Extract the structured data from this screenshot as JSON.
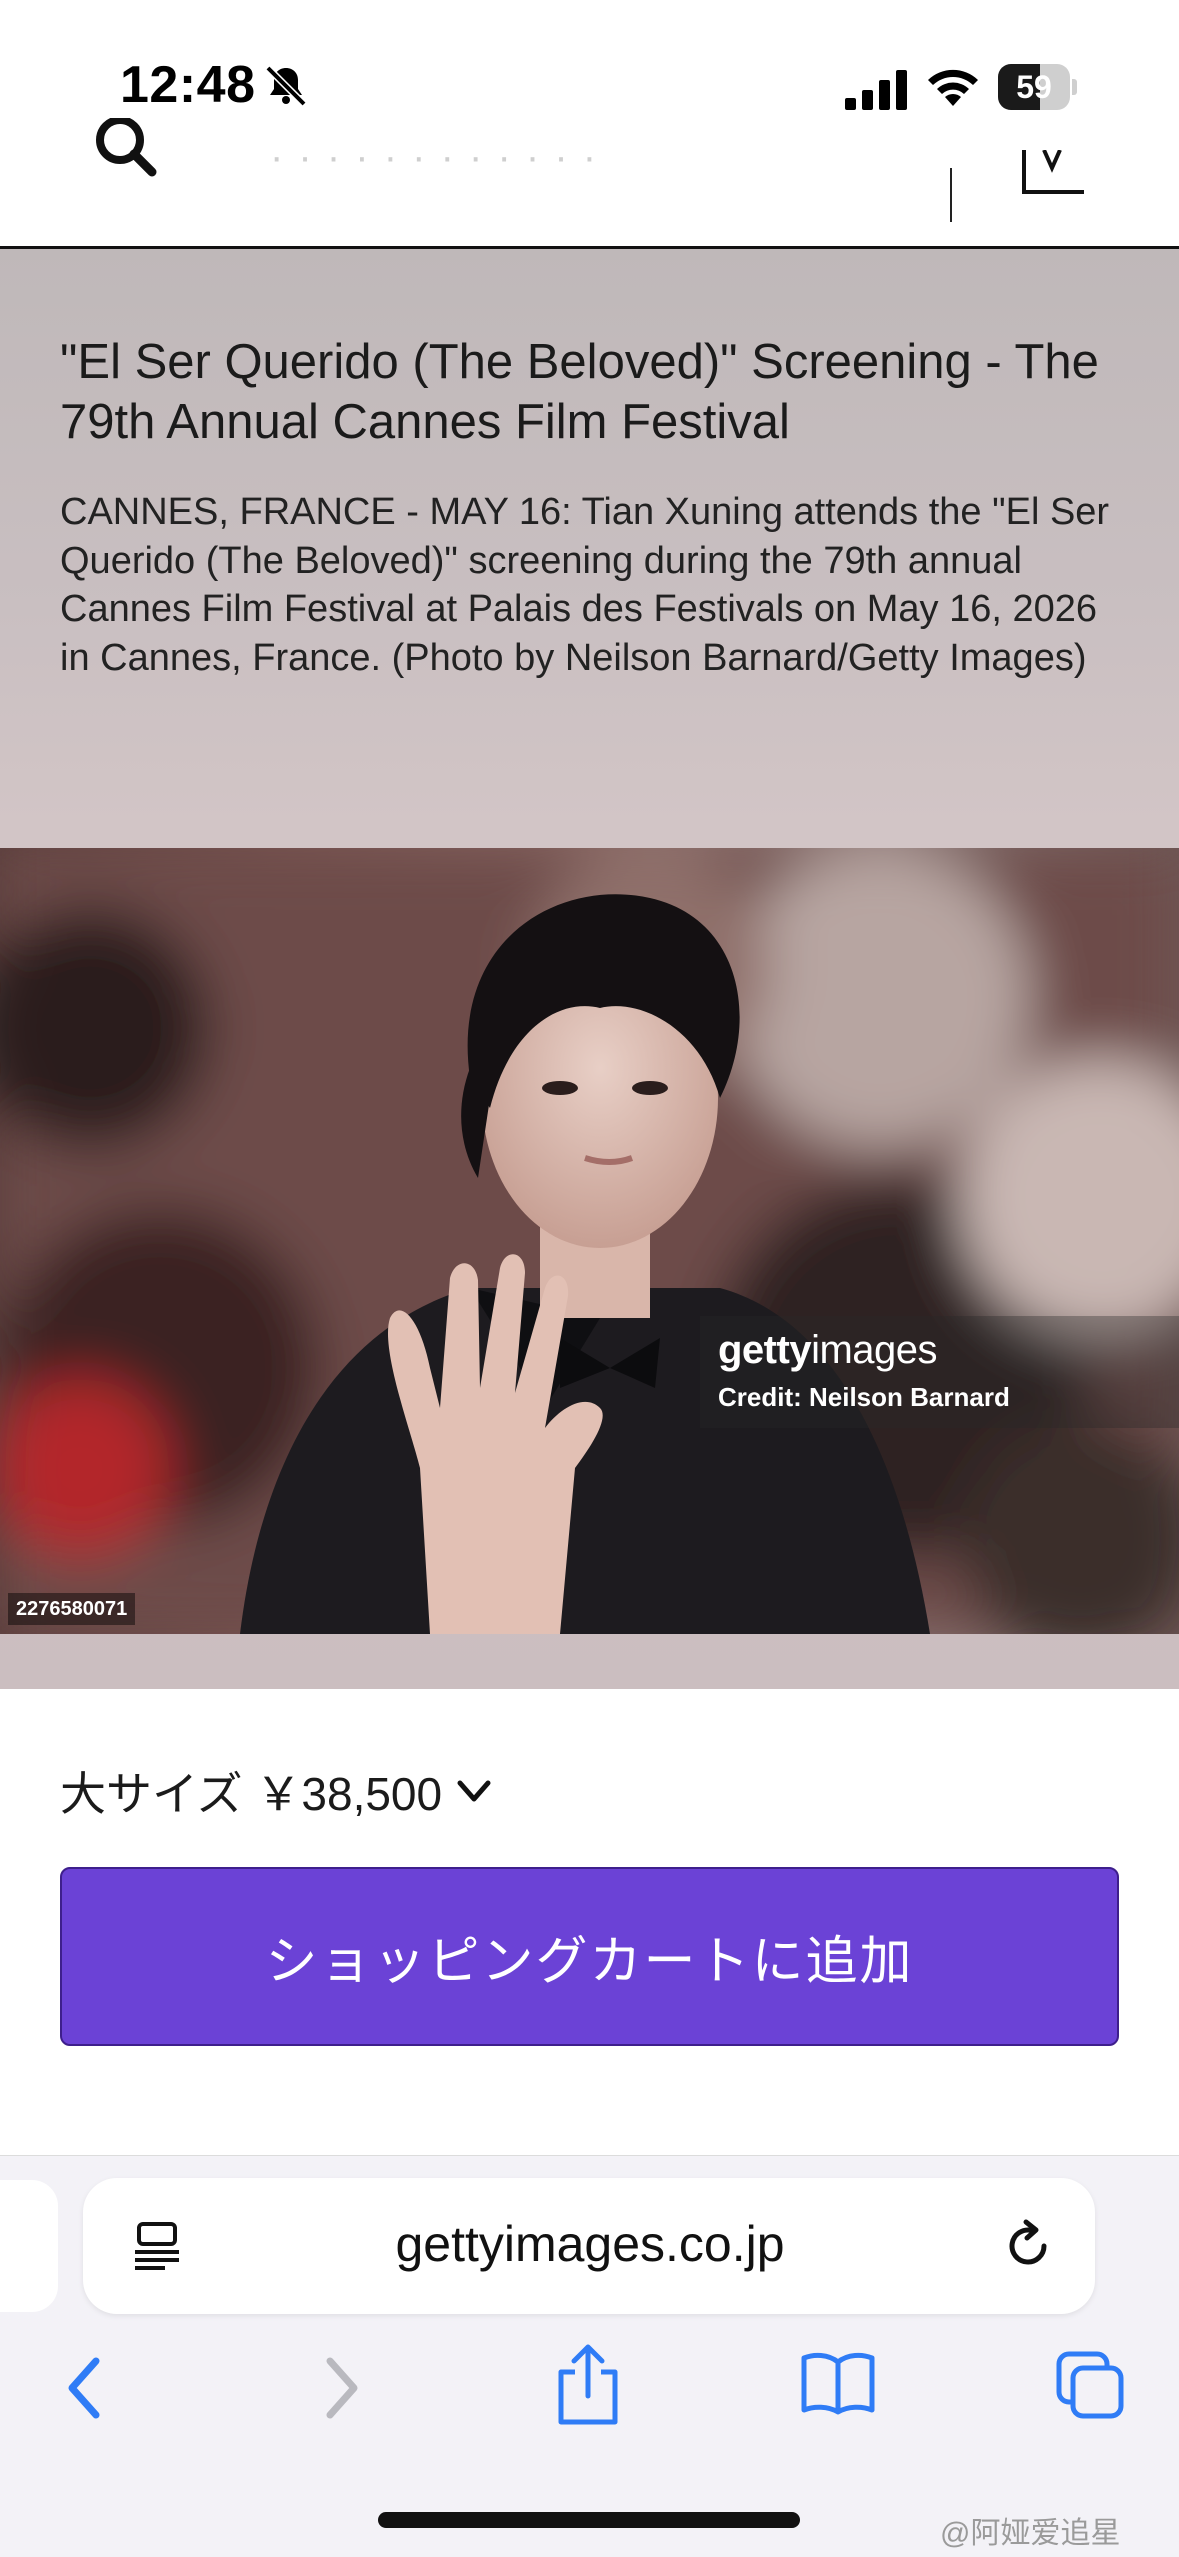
{
  "status_bar": {
    "time": "12:48",
    "battery_level": "59",
    "battery_fraction": 0.59,
    "icons": [
      "bell-slash-icon",
      "cellular-signal-icon",
      "wifi-icon",
      "battery-icon"
    ]
  },
  "header": {
    "icons": [
      "search-icon",
      "cart-icon"
    ]
  },
  "hero": {
    "title": "\"El Ser Querido (The Beloved)\" Screening - The 79th Annual Cannes Film Festival",
    "caption": "CANNES, FRANCE - MAY 16: Tian Xuning attends the \"El Ser Querido (The Beloved)\" screening during the 79th annual Cannes Film Festival at Palais des Festivals on May 16, 2026 in Cannes, France. (Photo by Neilson Barnard/Getty Images)",
    "image_id": "2276580071",
    "watermark_brand_a": "getty",
    "watermark_brand_b": "images",
    "watermark_credit": "Credit: Neilson Barnard"
  },
  "purchase": {
    "size_label": "大サイズ ￥38,500",
    "add_to_cart_label": "ショッピングカートに追加"
  },
  "safari": {
    "url": "gettyimages.co.jp",
    "icons": [
      "reader-icon",
      "reload-icon",
      "back-icon",
      "forward-icon",
      "share-icon",
      "bookmarks-icon",
      "tabs-icon"
    ]
  },
  "overlay": {
    "weibo_watermark": "@阿娅爱追星"
  },
  "colors": {
    "accent_button": "#6b42d6",
    "ios_blue": "#2f7cf6"
  }
}
